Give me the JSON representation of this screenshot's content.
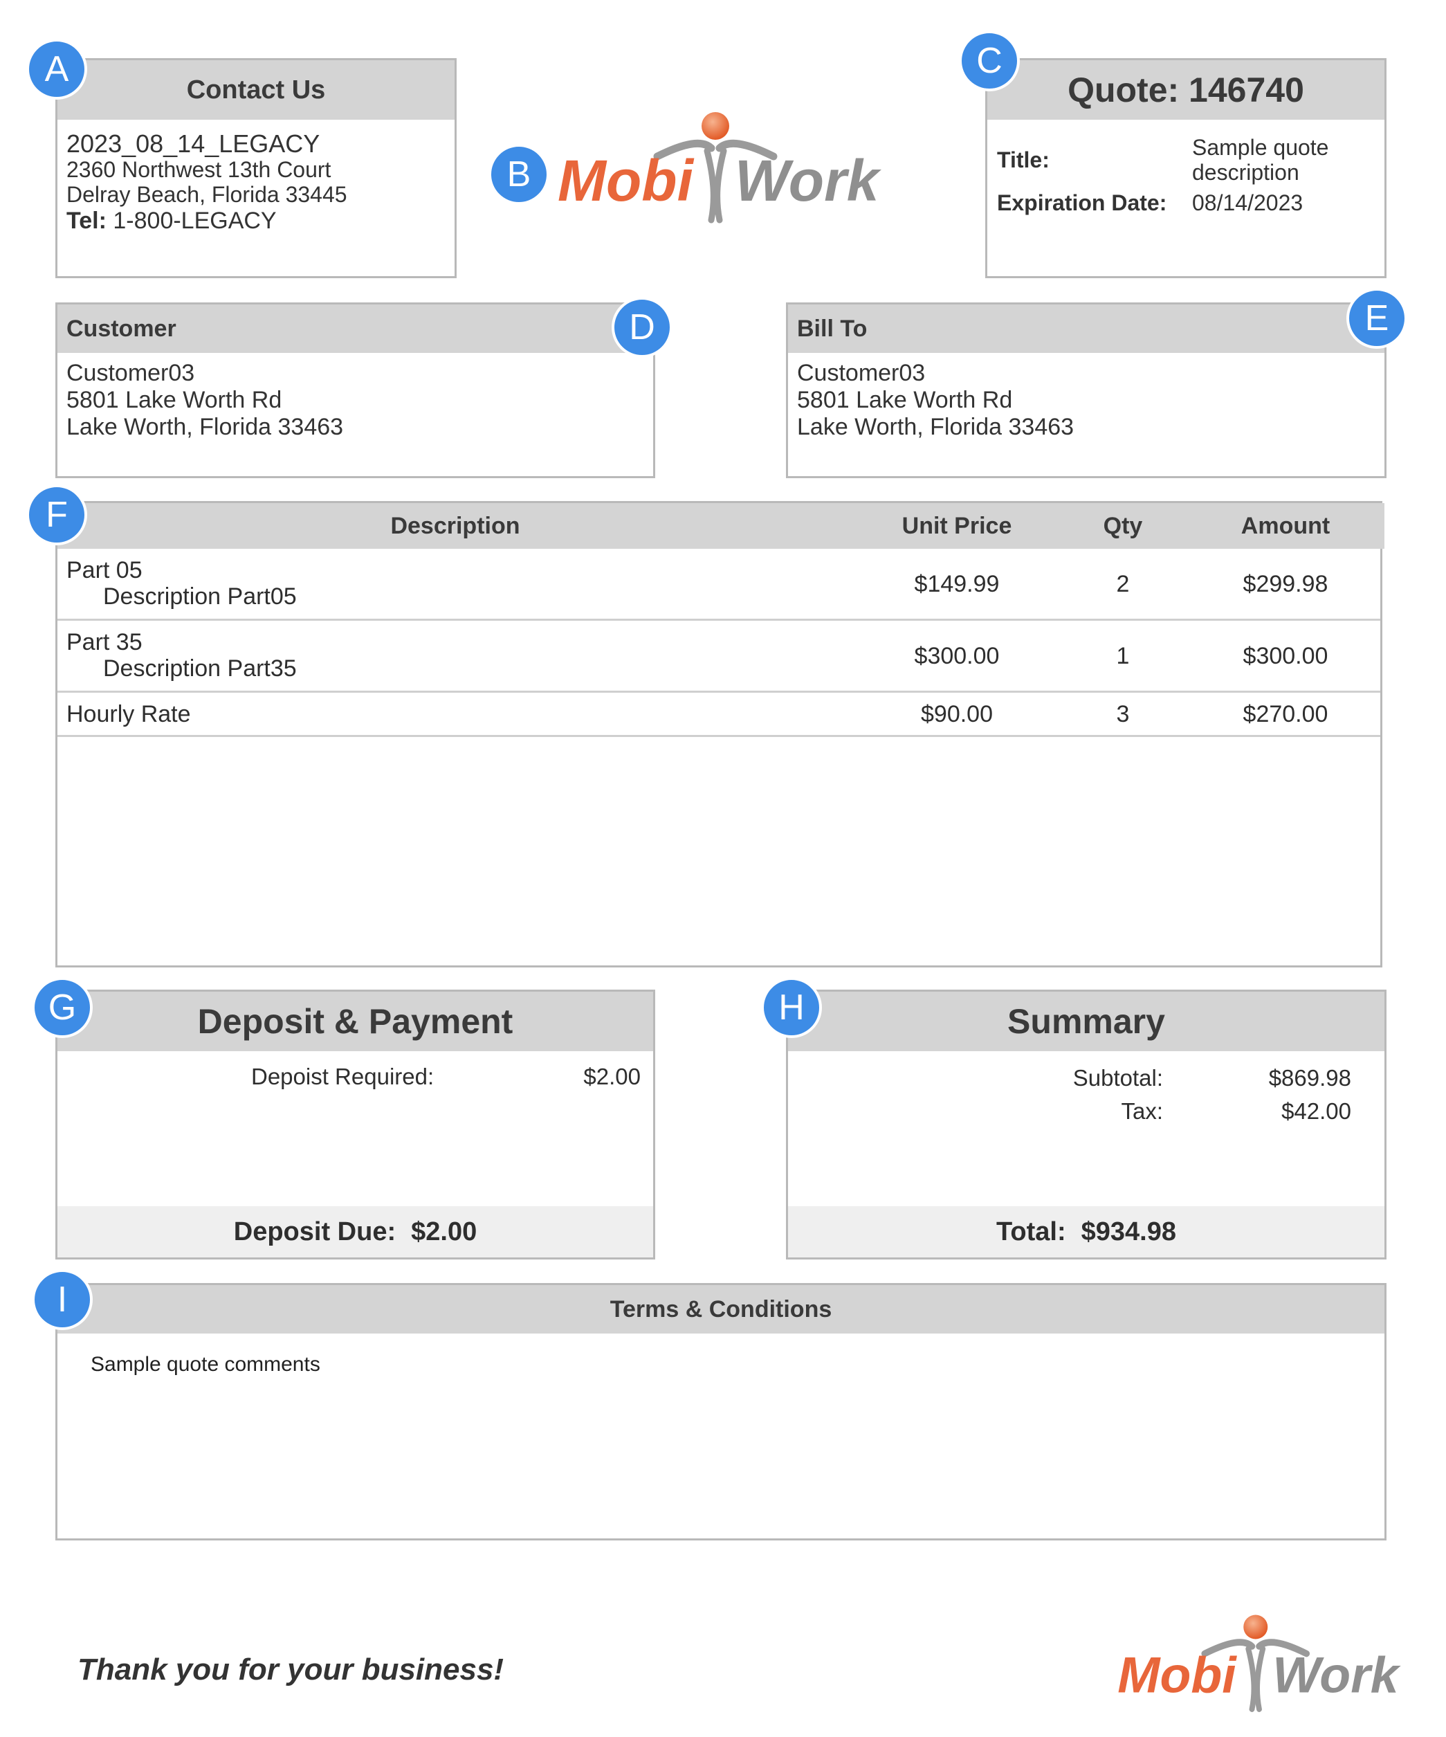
{
  "markers": {
    "a": "A",
    "b": "B",
    "c": "C",
    "d": "D",
    "e": "E",
    "f": "F",
    "g": "G",
    "h": "H",
    "i": "I"
  },
  "brand": {
    "part1": "Mobi",
    "part2": "Work",
    "orange": "#e8663a",
    "gray": "#8f8f8f"
  },
  "contact": {
    "heading": "Contact Us",
    "company": "2023_08_14_LEGACY",
    "street": "2360 Northwest 13th Court",
    "city": "Delray Beach, Florida 33445",
    "tel_label": "Tel:",
    "tel_value": "1-800-LEGACY"
  },
  "quote": {
    "heading": "Quote: 146740",
    "title_label": "Title:",
    "title_value": "Sample quote description",
    "exp_label": "Expiration Date:",
    "exp_value": "08/14/2023"
  },
  "customer": {
    "heading": "Customer",
    "name": "Customer03",
    "street": "5801 Lake Worth Rd",
    "city": "Lake Worth, Florida 33463"
  },
  "bill_to": {
    "heading": "Bill To",
    "name": "Customer03",
    "street": "5801 Lake Worth Rd",
    "city": "Lake Worth, Florida 33463"
  },
  "items": {
    "headers": {
      "description": "Description",
      "unit_price": "Unit Price",
      "qty": "Qty",
      "amount": "Amount"
    },
    "rows": [
      {
        "name": "Part 05",
        "description": "Description Part05",
        "unit_price": "$149.99",
        "qty": "2",
        "amount": "$299.98"
      },
      {
        "name": "Part 35",
        "description": "Description Part35",
        "unit_price": "$300.00",
        "qty": "1",
        "amount": "$300.00"
      },
      {
        "name": "Hourly Rate",
        "unit_price": "$90.00",
        "qty": "3",
        "amount": "$270.00"
      }
    ]
  },
  "deposit": {
    "heading": "Deposit & Payment",
    "required_label": "Depoist Required:",
    "required_value": "$2.00",
    "due_label": "Deposit Due:",
    "due_value": "$2.00"
  },
  "summary": {
    "heading": "Summary",
    "subtotal_label": "Subtotal:",
    "subtotal_value": "$869.98",
    "tax_label": "Tax:",
    "tax_value": "$42.00",
    "total_label": "Total:",
    "total_value": "$934.98"
  },
  "terms": {
    "heading": "Terms & Conditions",
    "comments": "Sample quote comments"
  },
  "footer": {
    "thanks": "Thank you for your business!"
  }
}
